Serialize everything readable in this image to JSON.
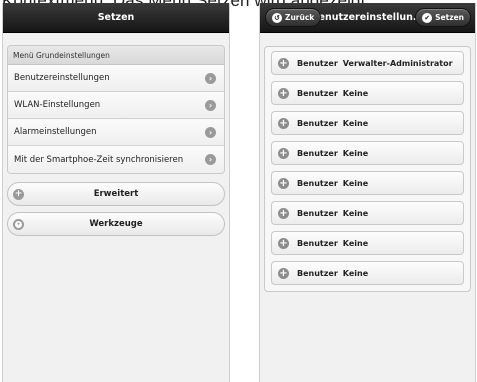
{
  "caption": "Kontextmenü: Das Menü Setzen wird angezeigt",
  "left": {
    "title": "Setzen",
    "group_header": "Menü Grundeinstellungen",
    "items": [
      {
        "label": "Benutzereinstellungen"
      },
      {
        "label": "WLAN-Einstellungen"
      },
      {
        "label": "Alarmeinstellungen"
      },
      {
        "label": "Mit der Smartphoe-Zeit synchronisieren"
      }
    ],
    "buttons": [
      {
        "label": "Erweitert",
        "icon": "plus-circle-icon"
      },
      {
        "label": "Werkzeuge",
        "icon": "gear-icon"
      }
    ]
  },
  "right": {
    "back_label": "Zurück",
    "title": "Benutzereinstellun...",
    "set_label": "Setzen",
    "users": [
      {
        "prefix": "Benutzer",
        "value": "Verwalter-Administrator"
      },
      {
        "prefix": "Benutzer",
        "value": "Keine"
      },
      {
        "prefix": "Benutzer",
        "value": "Keine"
      },
      {
        "prefix": "Benutzer",
        "value": "Keine"
      },
      {
        "prefix": "Benutzer",
        "value": "Keine"
      },
      {
        "prefix": "Benutzer",
        "value": "Keine"
      },
      {
        "prefix": "Benutzer",
        "value": "Keine"
      },
      {
        "prefix": "Benutzer",
        "value": "Keine"
      }
    ]
  },
  "colors": {
    "topbar": "#1e1e1e",
    "background": "#f1f1f1",
    "icon_gray": "#9a9a9a"
  }
}
